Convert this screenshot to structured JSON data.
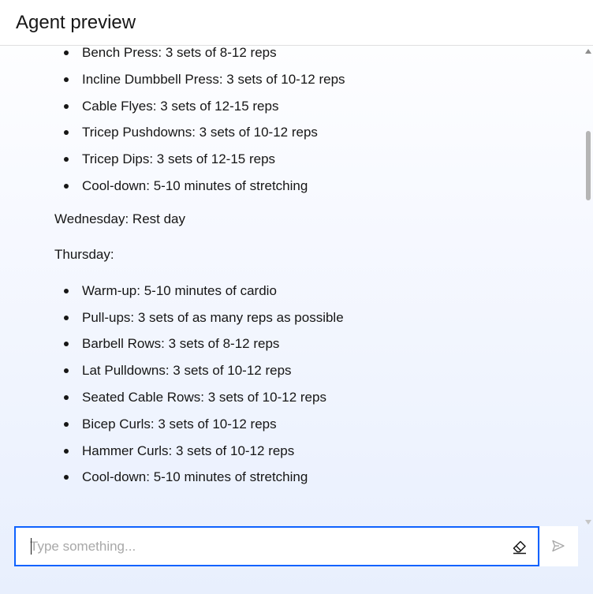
{
  "header": {
    "title": "Agent preview"
  },
  "message": {
    "list1": [
      "Bench Press: 3 sets of 8-12 reps",
      "Incline Dumbbell Press: 3 sets of 10-12 reps",
      "Cable Flyes: 3 sets of 12-15 reps",
      "Tricep Pushdowns: 3 sets of 10-12 reps",
      "Tricep Dips: 3 sets of 12-15 reps",
      "Cool-down: 5-10 minutes of stretching"
    ],
    "wednesday": "Wednesday: Rest day",
    "thursday": "Thursday:",
    "list2": [
      "Warm-up: 5-10 minutes of cardio",
      "Pull-ups: 3 sets of as many reps as possible",
      "Barbell Rows: 3 sets of 8-12 reps",
      "Lat Pulldowns: 3 sets of 10-12 reps",
      "Seated Cable Rows: 3 sets of 10-12 reps",
      "Bicep Curls: 3 sets of 10-12 reps",
      "Hammer Curls: 3 sets of 10-12 reps",
      "Cool-down: 5-10 minutes of stretching"
    ]
  },
  "composer": {
    "placeholder": "Type something...",
    "value": "",
    "clear_icon": "eraser-icon",
    "send_icon": "send-icon"
  },
  "colors": {
    "accent": "#0f62fe",
    "text": "#161616",
    "placeholder": "#a8a8a8"
  }
}
